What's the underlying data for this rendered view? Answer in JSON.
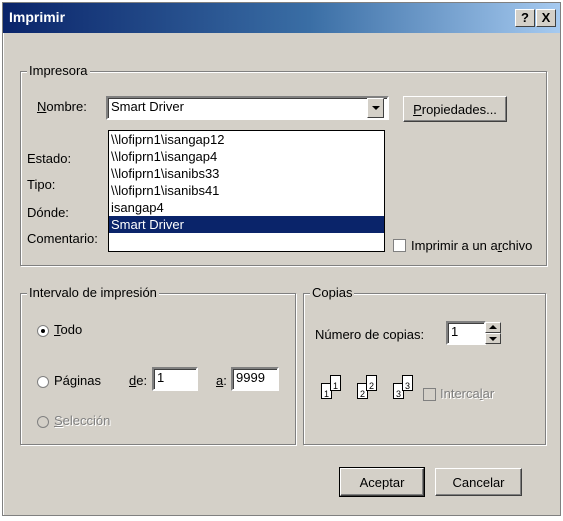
{
  "window": {
    "title": "Imprimir",
    "help_label": "?",
    "close_label": "X"
  },
  "printer": {
    "group_label": "Impresora",
    "name_label": "Nombre:",
    "status_label": "Estado:",
    "type_label": "Tipo:",
    "where_label": "Dónde:",
    "comment_label": "Comentario:",
    "selected": "Smart Driver",
    "options": [
      "\\\\lofiprn1\\isangap12",
      "\\\\lofiprn1\\isangap4",
      "\\\\lofiprn1\\isanibs33",
      "\\\\lofiprn1\\isanibs41",
      "isangap4",
      "Smart Driver"
    ],
    "properties_label": "Propiedades...",
    "print_to_file_label": "Imprimir a un archivo"
  },
  "range": {
    "group_label": "Intervalo de impresión",
    "all_label": "Todo",
    "pages_label": "Páginas",
    "from_label": "de:",
    "from_value": "1",
    "to_label": "a:",
    "to_value": "9999",
    "selection_label": "Selección"
  },
  "copies": {
    "group_label": "Copias",
    "count_label": "Número de copias:",
    "count_value": "1",
    "collate_label": "Intercalar",
    "collate_pages": [
      "1",
      "1",
      "2",
      "2",
      "3",
      "3"
    ]
  },
  "buttons": {
    "ok_label": "Aceptar",
    "cancel_label": "Cancelar"
  }
}
